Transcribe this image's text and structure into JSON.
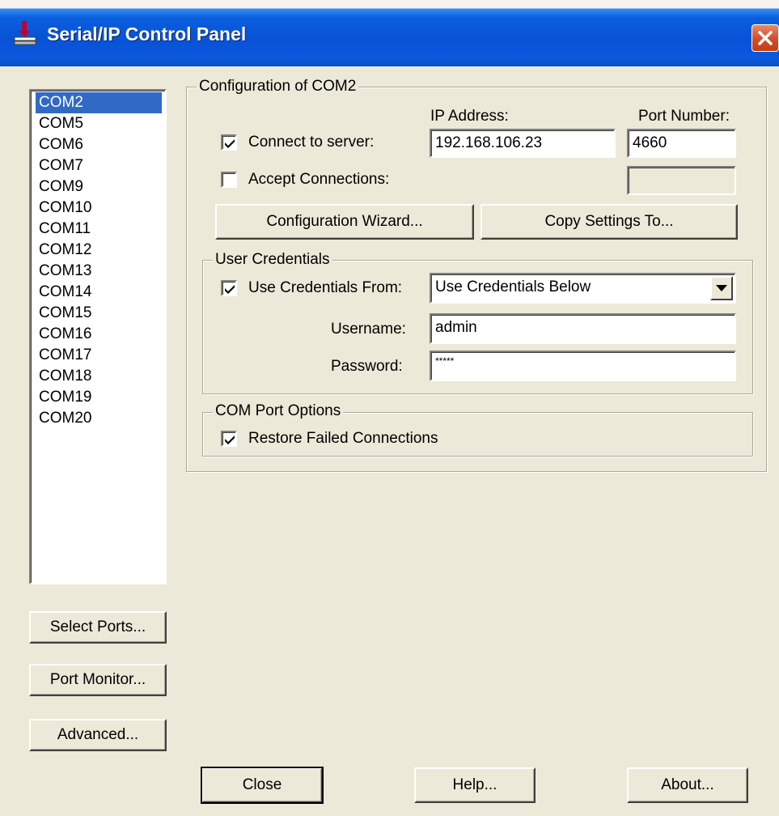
{
  "window": {
    "title": "Serial/IP Control Panel",
    "icon": "serial-connector-icon",
    "close_icon": "close-icon"
  },
  "ports": {
    "items": [
      "COM2",
      "COM5",
      "COM6",
      "COM7",
      "COM9",
      "COM10",
      "COM11",
      "COM12",
      "COM13",
      "COM14",
      "COM15",
      "COM16",
      "COM17",
      "COM18",
      "COM19",
      "COM20"
    ],
    "selected": "COM2"
  },
  "left_buttons": {
    "select_ports": "Select Ports...",
    "port_monitor": "Port Monitor...",
    "advanced": "Advanced..."
  },
  "config": {
    "group_label": "Configuration of COM2",
    "ip_header": "IP Address:",
    "port_header": "Port Number:",
    "connect_label": "Connect to server:",
    "connect_checked": true,
    "ip_value": "192.168.106.23",
    "port_value": "4660",
    "accept_label": "Accept Connections:",
    "accept_checked": false,
    "accept_port_value": "",
    "wizard_button": "Configuration Wizard...",
    "copy_button": "Copy Settings To..."
  },
  "credentials": {
    "group_label": "User Credentials",
    "use_from_label": "Use Credentials From:",
    "use_from_checked": true,
    "use_from_value": "Use Credentials Below",
    "username_label": "Username:",
    "username_value": "admin",
    "password_label": "Password:",
    "password_value": "*****"
  },
  "com_options": {
    "group_label": "COM Port Options",
    "restore_label": "Restore Failed Connections",
    "restore_checked": true
  },
  "bottom_buttons": {
    "close": "Close",
    "help": "Help...",
    "about": "About..."
  },
  "colors": {
    "selection": "#316ac5",
    "titlebar": "#0a5fde",
    "dialog": "#ece9d8"
  }
}
